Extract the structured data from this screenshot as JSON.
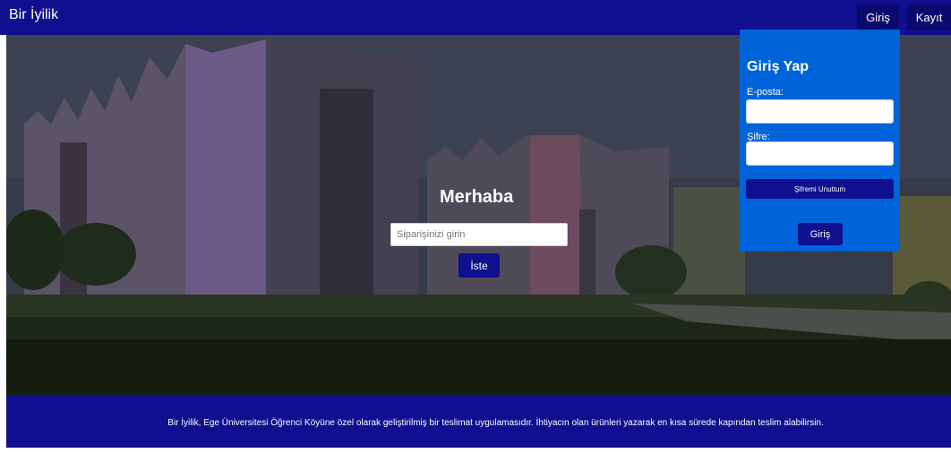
{
  "navbar": {
    "brand": "Bir İyilik",
    "login_label": "Giriş",
    "register_label": "Kayıt"
  },
  "hero": {
    "title": "Merhaba",
    "order_placeholder": "Siparişinizi girin",
    "order_button": "İste"
  },
  "login_panel": {
    "title": "Giriş Yap",
    "email_label": "E-posta:",
    "password_label": "Şifre:",
    "forgot_button": "Şifremi Unuttum",
    "submit_button": "Giriş"
  },
  "footer": {
    "text": "Bir İyilik, Ege Üniversitesi Öğrenci Köyüne özel olarak geliştirilmiş bir teslimat uygulamasıdır. İhtiyacın olan ürünleri yazarak en kısa sürede kapından teslim alabilirsin."
  },
  "colors": {
    "navbar": "#0f0f8f",
    "panel": "#0063d9",
    "button": "#0f0f8f"
  }
}
